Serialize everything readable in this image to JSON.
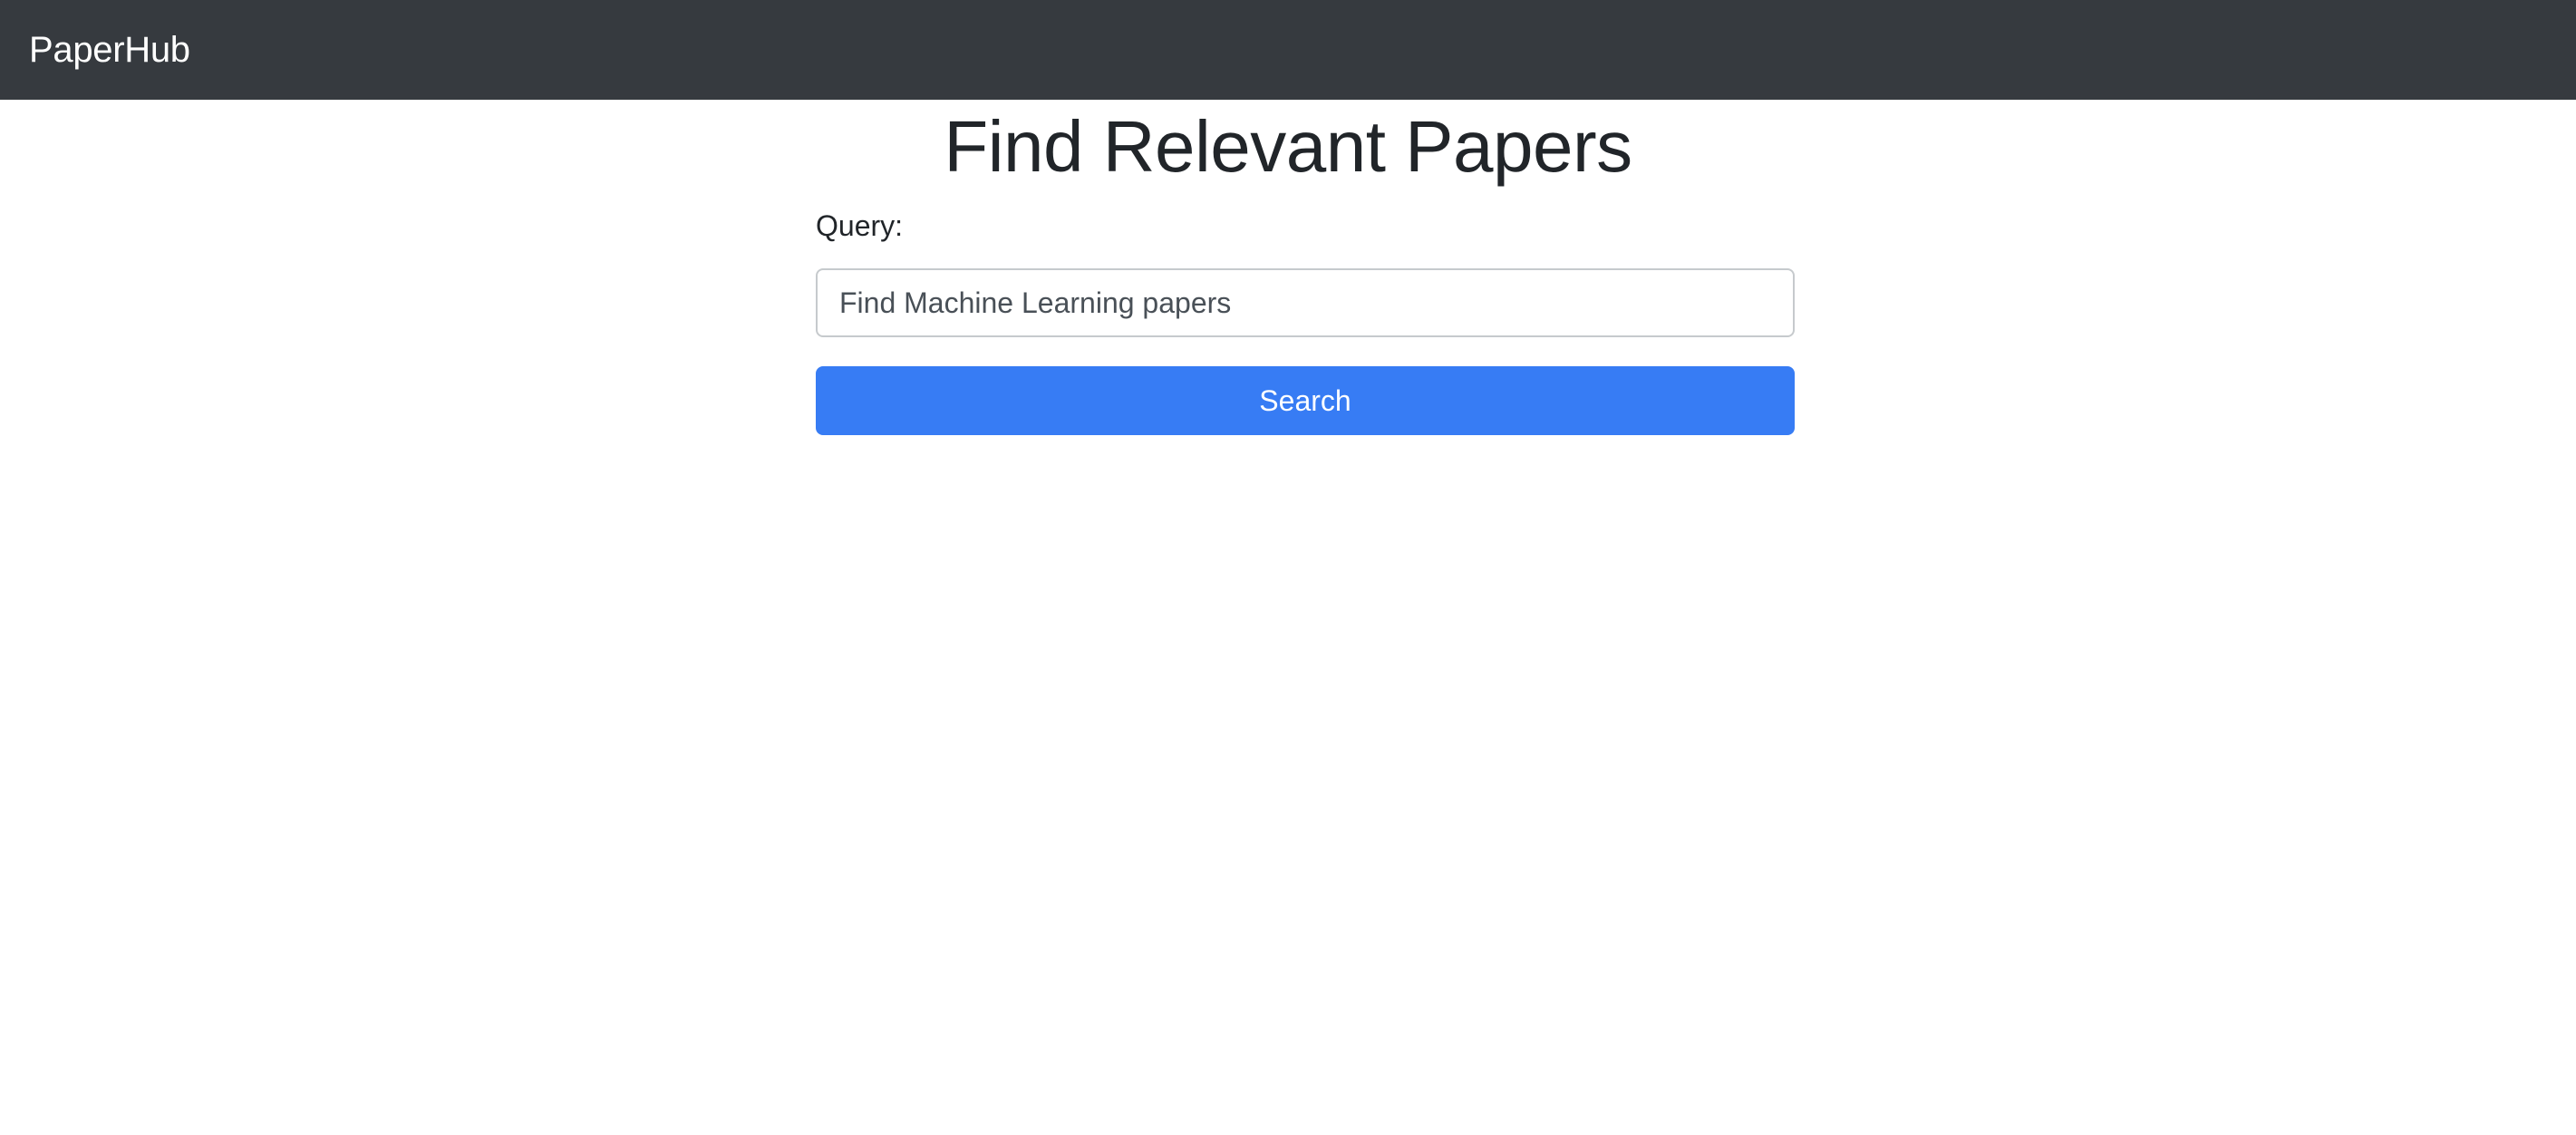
{
  "navbar": {
    "brand": "PaperHub",
    "background_color": "#363a3f"
  },
  "main": {
    "title": "Find Relevant Papers",
    "form": {
      "query_label": "Query:",
      "query_value": "Find Machine Learning papers",
      "search_label": "Search",
      "accent_color": "#377cf4"
    }
  }
}
